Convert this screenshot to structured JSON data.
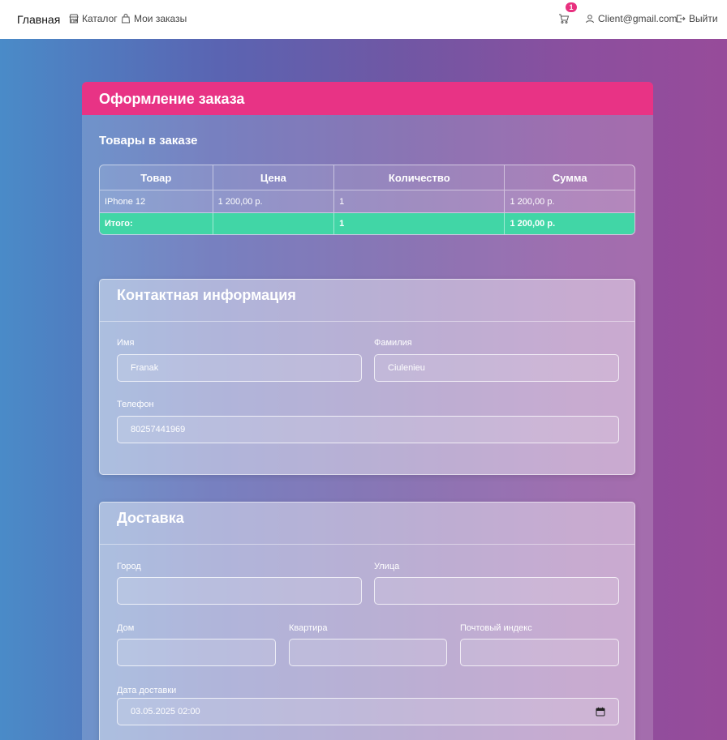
{
  "nav": {
    "brand": "Главная",
    "catalog": "Каталог",
    "orders": "Мои заказы",
    "cart_count": "1",
    "user_email": "Client@gmail.com",
    "logout": "Выйти"
  },
  "order": {
    "title": "Оформление заказа",
    "items_title": "Товары в заказе",
    "table": {
      "headers": [
        "Товар",
        "Цена",
        "Количество",
        "Сумма"
      ],
      "rows": [
        [
          "IPhone 12",
          "1 200,00 р.",
          "1",
          "1 200,00 р."
        ]
      ],
      "total": [
        "Итого:",
        "",
        "1",
        "1 200,00 р."
      ]
    }
  },
  "contact": {
    "title": "Контактная информация",
    "first_name_label": "Имя",
    "first_name_value": "Franak",
    "last_name_label": "Фамилия",
    "last_name_value": "Ciulenieu",
    "phone_label": "Телефон",
    "phone_value": "80257441969"
  },
  "delivery": {
    "title": "Доставка",
    "city_label": "Город",
    "city_value": "",
    "street_label": "Улица",
    "street_value": "",
    "house_label": "Дом",
    "house_value": "",
    "apartment_label": "Квартира",
    "apartment_value": "",
    "zip_label": "Почтовый индекс",
    "zip_value": "",
    "date_label": "Дата доставки",
    "date_value": "03.05.2025 02:00"
  },
  "colors": {
    "header_accent": "#e83385",
    "total_row": "#41d6a6",
    "badge": "#e8307f"
  }
}
